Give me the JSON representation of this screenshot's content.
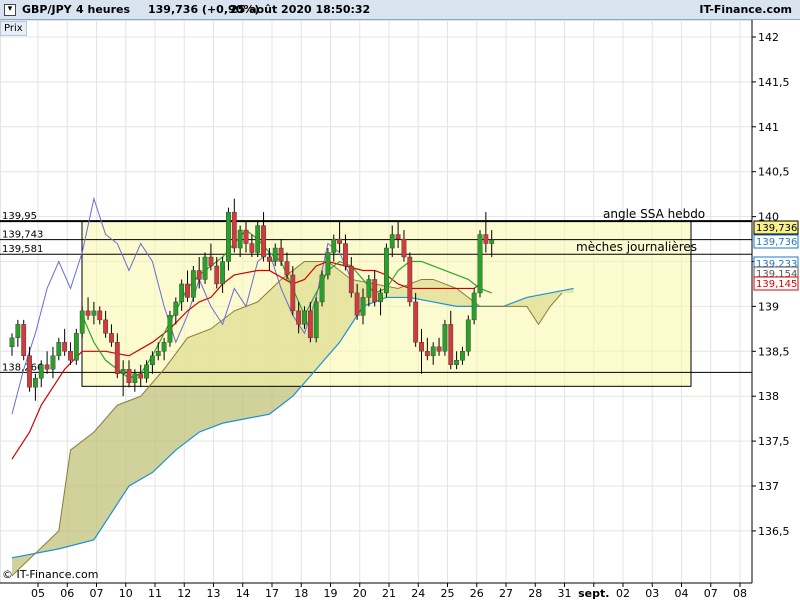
{
  "header": {
    "symbol": "GBP/JPY",
    "timeframe": "4 heures",
    "price_change": "139,736 (+0,90%)",
    "datetime": "25 août 2020 18:50:32",
    "site": "IT-Finance.com"
  },
  "panel_label": "Prix",
  "copyright": "© IT-Finance.com",
  "colors": {
    "up": "#2aa02a",
    "down": "#d23b3b",
    "wick": "#000000",
    "tenkan": "#d40000",
    "kijun": "#2fa52f",
    "chikou": "#6b6bd6",
    "ssb": "#1e90d6",
    "cloud_bull": "#c2c27a",
    "cloud_bear": "#a89a70",
    "zone": "#f8f8a8"
  },
  "chart_data": {
    "type": "candlestick",
    "ylim": [
      136.0,
      142.2
    ],
    "y_ticks": [
      "142",
      "141,5",
      "141",
      "140,5",
      "140",
      "139,5",
      "139",
      "138,5",
      "138",
      "137,5",
      "137",
      "136,5"
    ],
    "x_ticks": [
      "05",
      "06",
      "07",
      "10",
      "11",
      "12",
      "13",
      "14",
      "17",
      "18",
      "19",
      "20",
      "21",
      "24",
      "25",
      "26",
      "27",
      "28",
      "31",
      "sept.",
      "02",
      "03",
      "04",
      "07",
      "08"
    ],
    "levels": [
      {
        "value": 139.95,
        "label": "139,95",
        "note": "angle SSA hebdo"
      },
      {
        "value": 139.743,
        "label": "139,743",
        "note": ""
      },
      {
        "value": 139.581,
        "label": "139,581",
        "note": "mèches journalières"
      },
      {
        "value": 138.266,
        "label": "138,266",
        "note": ""
      }
    ],
    "zone": {
      "top": 139.95,
      "bottom": 138.11
    },
    "price_badges": [
      {
        "label": "139,736",
        "value": 139.736,
        "style": "current"
      },
      {
        "label": "139,736",
        "value": 139.736,
        "style": "blue"
      },
      {
        "label": "139,233",
        "value": 139.233,
        "style": "blue"
      },
      {
        "label": "139,154",
        "value": 139.154,
        "style": "gray"
      },
      {
        "label": "139,145",
        "value": 139.145,
        "style": "red"
      }
    ],
    "candles": [
      [
        138.55,
        138.7,
        138.45,
        138.65
      ],
      [
        138.65,
        138.85,
        138.55,
        138.8
      ],
      [
        138.8,
        138.85,
        138.4,
        138.45
      ],
      [
        138.45,
        138.55,
        138.05,
        138.1
      ],
      [
        138.1,
        138.25,
        137.95,
        138.2
      ],
      [
        138.2,
        138.4,
        138.1,
        138.35
      ],
      [
        138.35,
        138.5,
        138.25,
        138.3
      ],
      [
        138.3,
        138.55,
        138.2,
        138.45
      ],
      [
        138.45,
        138.65,
        138.4,
        138.6
      ],
      [
        138.6,
        138.75,
        138.45,
        138.5
      ],
      [
        138.5,
        138.6,
        138.35,
        138.4
      ],
      [
        138.4,
        138.75,
        138.35,
        138.7
      ],
      [
        138.7,
        139.0,
        138.65,
        138.95
      ],
      [
        138.95,
        139.1,
        138.85,
        138.9
      ],
      [
        138.9,
        139.05,
        138.8,
        138.95
      ],
      [
        138.95,
        139.0,
        138.8,
        138.85
      ],
      [
        138.85,
        138.95,
        138.65,
        138.7
      ],
      [
        138.7,
        138.8,
        138.55,
        138.6
      ],
      [
        138.6,
        138.7,
        138.2,
        138.25
      ],
      [
        138.25,
        138.4,
        138.0,
        138.3
      ],
      [
        138.3,
        138.4,
        138.1,
        138.15
      ],
      [
        138.15,
        138.3,
        138.05,
        138.25
      ],
      [
        138.25,
        138.35,
        138.1,
        138.2
      ],
      [
        138.2,
        138.4,
        138.15,
        138.35
      ],
      [
        138.35,
        138.5,
        138.25,
        138.45
      ],
      [
        138.45,
        138.6,
        138.4,
        138.5
      ],
      [
        138.5,
        138.65,
        138.4,
        138.6
      ],
      [
        138.6,
        138.95,
        138.55,
        138.9
      ],
      [
        138.9,
        139.1,
        138.8,
        139.05
      ],
      [
        139.05,
        139.3,
        138.95,
        139.25
      ],
      [
        139.25,
        139.4,
        139.05,
        139.1
      ],
      [
        139.1,
        139.45,
        139.05,
        139.4
      ],
      [
        139.4,
        139.55,
        139.2,
        139.3
      ],
      [
        139.3,
        139.6,
        139.25,
        139.55
      ],
      [
        139.55,
        139.7,
        139.4,
        139.45
      ],
      [
        139.45,
        139.55,
        139.2,
        139.25
      ],
      [
        139.25,
        139.55,
        139.15,
        139.5
      ],
      [
        139.5,
        140.1,
        139.4,
        140.05
      ],
      [
        140.05,
        140.2,
        139.6,
        139.65
      ],
      [
        139.65,
        139.9,
        139.55,
        139.85
      ],
      [
        139.85,
        139.95,
        139.6,
        139.7
      ],
      [
        139.7,
        139.8,
        139.55,
        139.6
      ],
      [
        139.6,
        139.95,
        139.55,
        139.9
      ],
      [
        139.9,
        140.05,
        139.5,
        139.55
      ],
      [
        139.55,
        139.65,
        139.4,
        139.5
      ],
      [
        139.5,
        139.7,
        139.45,
        139.65
      ],
      [
        139.65,
        139.75,
        139.45,
        139.5
      ],
      [
        139.5,
        139.6,
        139.3,
        139.35
      ],
      [
        139.35,
        139.45,
        138.9,
        138.95
      ],
      [
        138.95,
        139.05,
        138.7,
        138.8
      ],
      [
        138.8,
        139.0,
        138.75,
        138.95
      ],
      [
        138.95,
        139.05,
        138.6,
        138.65
      ],
      [
        138.65,
        139.1,
        138.6,
        139.05
      ],
      [
        139.05,
        139.4,
        139.0,
        139.35
      ],
      [
        139.35,
        139.65,
        139.3,
        139.6
      ],
      [
        139.6,
        139.8,
        139.5,
        139.75
      ],
      [
        139.75,
        139.95,
        139.6,
        139.7
      ],
      [
        139.7,
        139.8,
        139.4,
        139.45
      ],
      [
        139.45,
        139.55,
        139.1,
        139.15
      ],
      [
        139.15,
        139.25,
        138.85,
        138.9
      ],
      [
        138.9,
        139.2,
        138.8,
        139.1
      ],
      [
        139.1,
        139.35,
        139.0,
        139.3
      ],
      [
        139.3,
        139.4,
        139.0,
        139.05
      ],
      [
        139.05,
        139.2,
        138.9,
        139.15
      ],
      [
        139.15,
        139.7,
        139.1,
        139.65
      ],
      [
        139.65,
        139.9,
        139.55,
        139.8
      ],
      [
        139.8,
        139.95,
        139.65,
        139.75
      ],
      [
        139.75,
        139.85,
        139.5,
        139.55
      ],
      [
        139.55,
        139.6,
        139.0,
        139.05
      ],
      [
        139.05,
        139.15,
        138.55,
        138.6
      ],
      [
        138.6,
        138.75,
        138.25,
        138.5
      ],
      [
        138.5,
        138.65,
        138.4,
        138.45
      ],
      [
        138.45,
        138.6,
        138.35,
        138.55
      ],
      [
        138.55,
        138.65,
        138.45,
        138.5
      ],
      [
        138.5,
        138.85,
        138.45,
        138.8
      ],
      [
        138.8,
        138.95,
        138.3,
        138.35
      ],
      [
        138.35,
        138.5,
        138.3,
        138.4
      ],
      [
        138.4,
        138.55,
        138.35,
        138.5
      ],
      [
        138.5,
        138.9,
        138.45,
        138.85
      ],
      [
        138.85,
        139.2,
        138.8,
        139.15
      ],
      [
        139.15,
        139.85,
        139.1,
        139.8
      ],
      [
        139.8,
        140.05,
        139.6,
        139.7
      ],
      [
        139.7,
        139.85,
        139.55,
        139.74
      ]
    ],
    "tenkan": [
      [
        0,
        137.3
      ],
      [
        3,
        137.6
      ],
      [
        5,
        137.9
      ],
      [
        9,
        138.3
      ],
      [
        12,
        138.5
      ],
      [
        16,
        138.5
      ],
      [
        20,
        138.45
      ],
      [
        24,
        138.6
      ],
      [
        27,
        138.75
      ],
      [
        30,
        138.95
      ],
      [
        32,
        139.05
      ],
      [
        34,
        139.1
      ],
      [
        36,
        139.25
      ],
      [
        38,
        139.35
      ],
      [
        42,
        139.4
      ],
      [
        44,
        139.4
      ],
      [
        48,
        139.25
      ],
      [
        50,
        139.3
      ],
      [
        52,
        139.45
      ],
      [
        54,
        139.5
      ],
      [
        57,
        139.45
      ],
      [
        60,
        139.4
      ],
      [
        62,
        139.4
      ],
      [
        64,
        139.35
      ],
      [
        66,
        139.25
      ],
      [
        68,
        139.2
      ],
      [
        70,
        139.2
      ],
      [
        73,
        139.2
      ],
      [
        76,
        139.2
      ],
      [
        79,
        139.2
      ],
      [
        80,
        139.25
      ]
    ],
    "kijun": [
      [
        12,
        138.9
      ],
      [
        14,
        138.6
      ],
      [
        16,
        138.4
      ],
      [
        18,
        138.3
      ],
      [
        20,
        138.2
      ],
      [
        22,
        138.25
      ],
      [
        24,
        138.45
      ],
      [
        26,
        138.7
      ],
      [
        28,
        138.95
      ],
      [
        30,
        139.2
      ],
      [
        32,
        139.35
      ],
      [
        34,
        139.45
      ],
      [
        36,
        139.55
      ],
      [
        38,
        139.7
      ],
      [
        40,
        139.85
      ],
      [
        42,
        139.75
      ],
      [
        44,
        139.6
      ],
      [
        46,
        139.5
      ],
      [
        48,
        139.2
      ],
      [
        50,
        138.9
      ],
      [
        52,
        139.15
      ],
      [
        54,
        139.4
      ],
      [
        56,
        139.5
      ],
      [
        58,
        139.45
      ],
      [
        60,
        139.3
      ],
      [
        62,
        139.15
      ],
      [
        64,
        139.2
      ],
      [
        66,
        139.4
      ],
      [
        68,
        139.5
      ],
      [
        70,
        139.5
      ],
      [
        72,
        139.45
      ],
      [
        74,
        139.4
      ],
      [
        76,
        139.35
      ],
      [
        78,
        139.3
      ],
      [
        80,
        139.2
      ],
      [
        82,
        139.15
      ]
    ],
    "chikou": [
      [
        0,
        137.8
      ],
      [
        2,
        138.3
      ],
      [
        4,
        138.7
      ],
      [
        6,
        139.2
      ],
      [
        8,
        139.5
      ],
      [
        10,
        139.2
      ],
      [
        12,
        139.6
      ],
      [
        14,
        140.2
      ],
      [
        16,
        139.8
      ],
      [
        18,
        139.7
      ],
      [
        20,
        139.4
      ],
      [
        22,
        139.7
      ],
      [
        24,
        139.5
      ],
      [
        26,
        139.0
      ],
      [
        28,
        138.6
      ],
      [
        30,
        138.9
      ],
      [
        32,
        139.3
      ],
      [
        34,
        139.0
      ],
      [
        36,
        138.8
      ],
      [
        38,
        139.2
      ],
      [
        40,
        139.0
      ],
      [
        42,
        139.5
      ],
      [
        44,
        139.6
      ],
      [
        46,
        139.2
      ],
      [
        48,
        138.9
      ],
      [
        50,
        138.7
      ],
      [
        52,
        139.1
      ],
      [
        54,
        139.7
      ],
      [
        56,
        139.6
      ],
      [
        58,
        139.3
      ]
    ],
    "ssb": [
      [
        0,
        136.2
      ],
      [
        8,
        136.3
      ],
      [
        14,
        136.4
      ],
      [
        20,
        137.0
      ],
      [
        24,
        137.15
      ],
      [
        28,
        137.4
      ],
      [
        32,
        137.6
      ],
      [
        36,
        137.7
      ],
      [
        40,
        137.75
      ],
      [
        44,
        137.8
      ],
      [
        48,
        138.0
      ],
      [
        52,
        138.3
      ],
      [
        56,
        138.6
      ],
      [
        60,
        139.0
      ],
      [
        64,
        139.1
      ],
      [
        68,
        139.1
      ],
      [
        72,
        139.05
      ],
      [
        76,
        139.0
      ],
      [
        80,
        139.0
      ],
      [
        84,
        139.0
      ],
      [
        88,
        139.1
      ],
      [
        92,
        139.15
      ],
      [
        96,
        139.2
      ]
    ],
    "ssa": [
      [
        0,
        136.0
      ],
      [
        8,
        136.5
      ],
      [
        10,
        137.4
      ],
      [
        14,
        137.6
      ],
      [
        18,
        137.9
      ],
      [
        22,
        138.0
      ],
      [
        26,
        138.3
      ],
      [
        30,
        138.65
      ],
      [
        34,
        138.75
      ],
      [
        38,
        138.95
      ],
      [
        42,
        139.05
      ],
      [
        46,
        139.3
      ],
      [
        50,
        139.5
      ],
      [
        54,
        139.5
      ],
      [
        58,
        139.3
      ],
      [
        62,
        139.25
      ],
      [
        66,
        139.2
      ],
      [
        70,
        139.3
      ],
      [
        72,
        139.3
      ],
      [
        76,
        139.2
      ],
      [
        80,
        139.0
      ],
      [
        84,
        139.0
      ],
      [
        88,
        139.0
      ],
      [
        90,
        138.8
      ],
      [
        92,
        139.0
      ],
      [
        94,
        139.15
      ]
    ]
  }
}
